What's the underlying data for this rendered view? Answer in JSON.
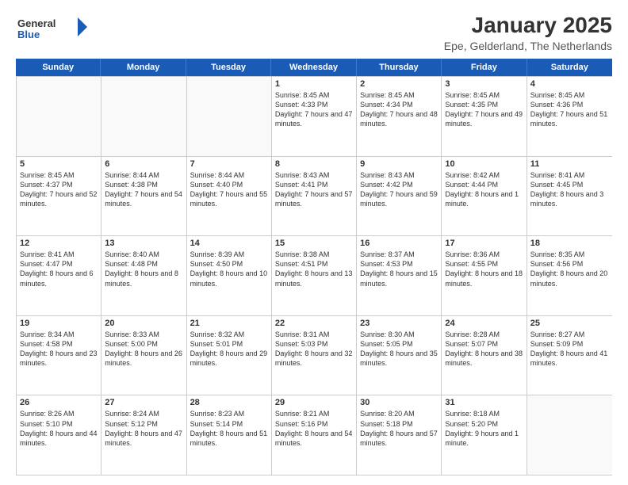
{
  "logo": {
    "general": "General",
    "blue": "Blue"
  },
  "title": "January 2025",
  "subtitle": "Epe, Gelderland, The Netherlands",
  "days": [
    "Sunday",
    "Monday",
    "Tuesday",
    "Wednesday",
    "Thursday",
    "Friday",
    "Saturday"
  ],
  "weeks": [
    [
      {
        "day": "",
        "info": ""
      },
      {
        "day": "",
        "info": ""
      },
      {
        "day": "",
        "info": ""
      },
      {
        "day": "1",
        "info": "Sunrise: 8:45 AM\nSunset: 4:33 PM\nDaylight: 7 hours and 47 minutes."
      },
      {
        "day": "2",
        "info": "Sunrise: 8:45 AM\nSunset: 4:34 PM\nDaylight: 7 hours and 48 minutes."
      },
      {
        "day": "3",
        "info": "Sunrise: 8:45 AM\nSunset: 4:35 PM\nDaylight: 7 hours and 49 minutes."
      },
      {
        "day": "4",
        "info": "Sunrise: 8:45 AM\nSunset: 4:36 PM\nDaylight: 7 hours and 51 minutes."
      }
    ],
    [
      {
        "day": "5",
        "info": "Sunrise: 8:45 AM\nSunset: 4:37 PM\nDaylight: 7 hours and 52 minutes."
      },
      {
        "day": "6",
        "info": "Sunrise: 8:44 AM\nSunset: 4:38 PM\nDaylight: 7 hours and 54 minutes."
      },
      {
        "day": "7",
        "info": "Sunrise: 8:44 AM\nSunset: 4:40 PM\nDaylight: 7 hours and 55 minutes."
      },
      {
        "day": "8",
        "info": "Sunrise: 8:43 AM\nSunset: 4:41 PM\nDaylight: 7 hours and 57 minutes."
      },
      {
        "day": "9",
        "info": "Sunrise: 8:43 AM\nSunset: 4:42 PM\nDaylight: 7 hours and 59 minutes."
      },
      {
        "day": "10",
        "info": "Sunrise: 8:42 AM\nSunset: 4:44 PM\nDaylight: 8 hours and 1 minute."
      },
      {
        "day": "11",
        "info": "Sunrise: 8:41 AM\nSunset: 4:45 PM\nDaylight: 8 hours and 3 minutes."
      }
    ],
    [
      {
        "day": "12",
        "info": "Sunrise: 8:41 AM\nSunset: 4:47 PM\nDaylight: 8 hours and 6 minutes."
      },
      {
        "day": "13",
        "info": "Sunrise: 8:40 AM\nSunset: 4:48 PM\nDaylight: 8 hours and 8 minutes."
      },
      {
        "day": "14",
        "info": "Sunrise: 8:39 AM\nSunset: 4:50 PM\nDaylight: 8 hours and 10 minutes."
      },
      {
        "day": "15",
        "info": "Sunrise: 8:38 AM\nSunset: 4:51 PM\nDaylight: 8 hours and 13 minutes."
      },
      {
        "day": "16",
        "info": "Sunrise: 8:37 AM\nSunset: 4:53 PM\nDaylight: 8 hours and 15 minutes."
      },
      {
        "day": "17",
        "info": "Sunrise: 8:36 AM\nSunset: 4:55 PM\nDaylight: 8 hours and 18 minutes."
      },
      {
        "day": "18",
        "info": "Sunrise: 8:35 AM\nSunset: 4:56 PM\nDaylight: 8 hours and 20 minutes."
      }
    ],
    [
      {
        "day": "19",
        "info": "Sunrise: 8:34 AM\nSunset: 4:58 PM\nDaylight: 8 hours and 23 minutes."
      },
      {
        "day": "20",
        "info": "Sunrise: 8:33 AM\nSunset: 5:00 PM\nDaylight: 8 hours and 26 minutes."
      },
      {
        "day": "21",
        "info": "Sunrise: 8:32 AM\nSunset: 5:01 PM\nDaylight: 8 hours and 29 minutes."
      },
      {
        "day": "22",
        "info": "Sunrise: 8:31 AM\nSunset: 5:03 PM\nDaylight: 8 hours and 32 minutes."
      },
      {
        "day": "23",
        "info": "Sunrise: 8:30 AM\nSunset: 5:05 PM\nDaylight: 8 hours and 35 minutes."
      },
      {
        "day": "24",
        "info": "Sunrise: 8:28 AM\nSunset: 5:07 PM\nDaylight: 8 hours and 38 minutes."
      },
      {
        "day": "25",
        "info": "Sunrise: 8:27 AM\nSunset: 5:09 PM\nDaylight: 8 hours and 41 minutes."
      }
    ],
    [
      {
        "day": "26",
        "info": "Sunrise: 8:26 AM\nSunset: 5:10 PM\nDaylight: 8 hours and 44 minutes."
      },
      {
        "day": "27",
        "info": "Sunrise: 8:24 AM\nSunset: 5:12 PM\nDaylight: 8 hours and 47 minutes."
      },
      {
        "day": "28",
        "info": "Sunrise: 8:23 AM\nSunset: 5:14 PM\nDaylight: 8 hours and 51 minutes."
      },
      {
        "day": "29",
        "info": "Sunrise: 8:21 AM\nSunset: 5:16 PM\nDaylight: 8 hours and 54 minutes."
      },
      {
        "day": "30",
        "info": "Sunrise: 8:20 AM\nSunset: 5:18 PM\nDaylight: 8 hours and 57 minutes."
      },
      {
        "day": "31",
        "info": "Sunrise: 8:18 AM\nSunset: 5:20 PM\nDaylight: 9 hours and 1 minute."
      },
      {
        "day": "",
        "info": ""
      }
    ]
  ]
}
